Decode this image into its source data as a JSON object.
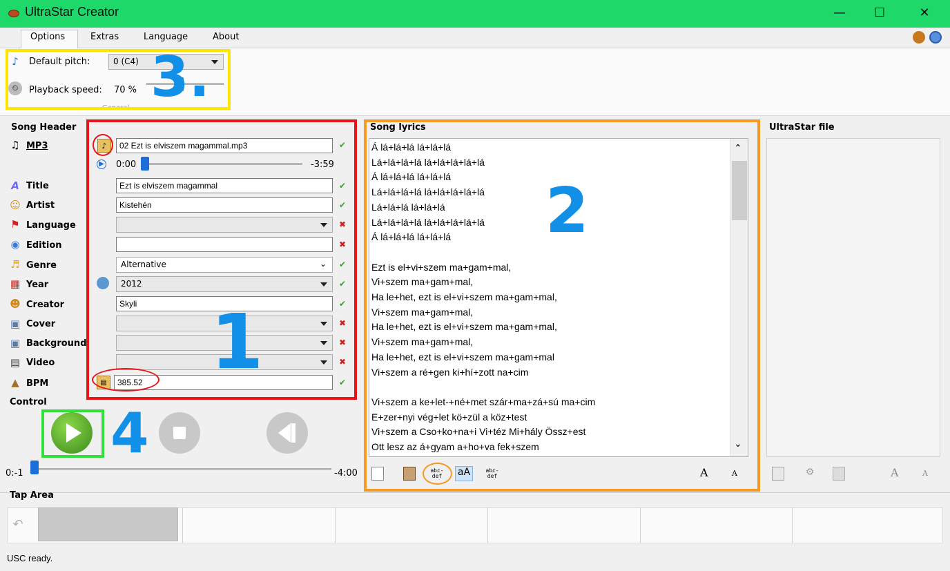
{
  "window": {
    "title": "UltraStar Creator",
    "minimize": "—",
    "maximize": "☐",
    "close": "✕"
  },
  "menu": {
    "items": [
      {
        "label": "Options"
      },
      {
        "label": "Extras"
      },
      {
        "label": "Language"
      },
      {
        "label": "About"
      }
    ]
  },
  "options": {
    "default_pitch_label": "Default pitch:",
    "default_pitch_value": "0 (C4)",
    "playback_speed_label": "Playback speed:",
    "playback_speed_value": "70 %",
    "playback_speed_fraction": 0.7,
    "group_label": "General"
  },
  "song_header": {
    "title": "Song Header",
    "fields": [
      {
        "label": "MP3",
        "value": "02 Ezt is elviszem magammal.mp3",
        "status": "ok"
      },
      {
        "label": "Title",
        "value": "Ezt is elviszem magammal",
        "status": "ok"
      },
      {
        "label": "Artist",
        "value": "Kistehén",
        "status": "ok"
      },
      {
        "label": "Language",
        "value": "",
        "status": "bad"
      },
      {
        "label": "Edition",
        "value": "",
        "status": "bad"
      },
      {
        "label": "Genre",
        "value": "Alternative",
        "status": "ok"
      },
      {
        "label": "Year",
        "value": "2012",
        "status": "ok"
      },
      {
        "label": "Creator",
        "value": "Skyli",
        "status": "ok"
      },
      {
        "label": "Cover",
        "value": "",
        "status": "bad"
      },
      {
        "label": "Background",
        "value": "",
        "status": "bad"
      },
      {
        "label": "Video",
        "value": "",
        "status": "bad"
      },
      {
        "label": "BPM",
        "value": "385.52",
        "status": "ok"
      }
    ],
    "mp3_time_start": "0:00",
    "mp3_time_end": "-3:59"
  },
  "control": {
    "title": "Control",
    "time_start": "0:-1",
    "time_end": "-4:00"
  },
  "lyrics": {
    "title": "Song lyrics",
    "lines": [
      "Á lá+lá+lá lá+lá+lá",
      "Lá+lá+lá+lá lá+lá+lá+lá+lá",
      "Á lá+lá+lá lá+lá+lá",
      "Lá+lá+lá+lá lá+lá+lá+lá+lá",
      "Lá+lá+lá lá+lá+lá",
      "Lá+lá+lá+lá lá+lá+lá+lá+lá",
      "Á lá+lá+lá lá+lá+lá",
      "",
      "Ezt is el+vi+szem ma+gam+mal,",
      "Vi+szem ma+gam+mal,",
      "Ha le+het, ezt is el+vi+szem ma+gam+mal,",
      "Vi+szem ma+gam+mal,",
      "Ha le+het, ezt is el+vi+szem ma+gam+mal,",
      "Vi+szem ma+gam+mal,",
      "Ha le+het, ezt is el+vi+szem ma+gam+mal",
      "Vi+szem a ré+gen ki+hí+zott na+cim",
      "",
      "Vi+szem a ke+let-+né+met szár+ma+zá+sú ma+cim",
      "E+zer+nyi vég+let kö+zül a köz+test",
      "Vi+szem a Cso+ko+na+i Vi+téz Mi+hály Össz+est",
      "Ott lesz az á+gyam a+ho+va fek+szem"
    ]
  },
  "ultrastar_file": {
    "title": "UltraStar file"
  },
  "tap_area": {
    "title": "Tap Area"
  },
  "status_bar": {
    "text": "USC ready."
  },
  "annotations": {
    "n1": "1",
    "n2": "2",
    "n3": "3.",
    "n4": "4"
  },
  "toolbar": {
    "abc_top": "abc-",
    "abc_bottom": "def",
    "case": "aA",
    "font_bigger": "A",
    "font_smaller": "A"
  },
  "colors": {
    "titlebar": "#1fd86a",
    "highlight_options": "#ffe600",
    "highlight_header": "#e8141a",
    "highlight_lyrics": "#f59a23",
    "highlight_play": "#2fe13a",
    "annotation_numbers": "#1290e8"
  }
}
